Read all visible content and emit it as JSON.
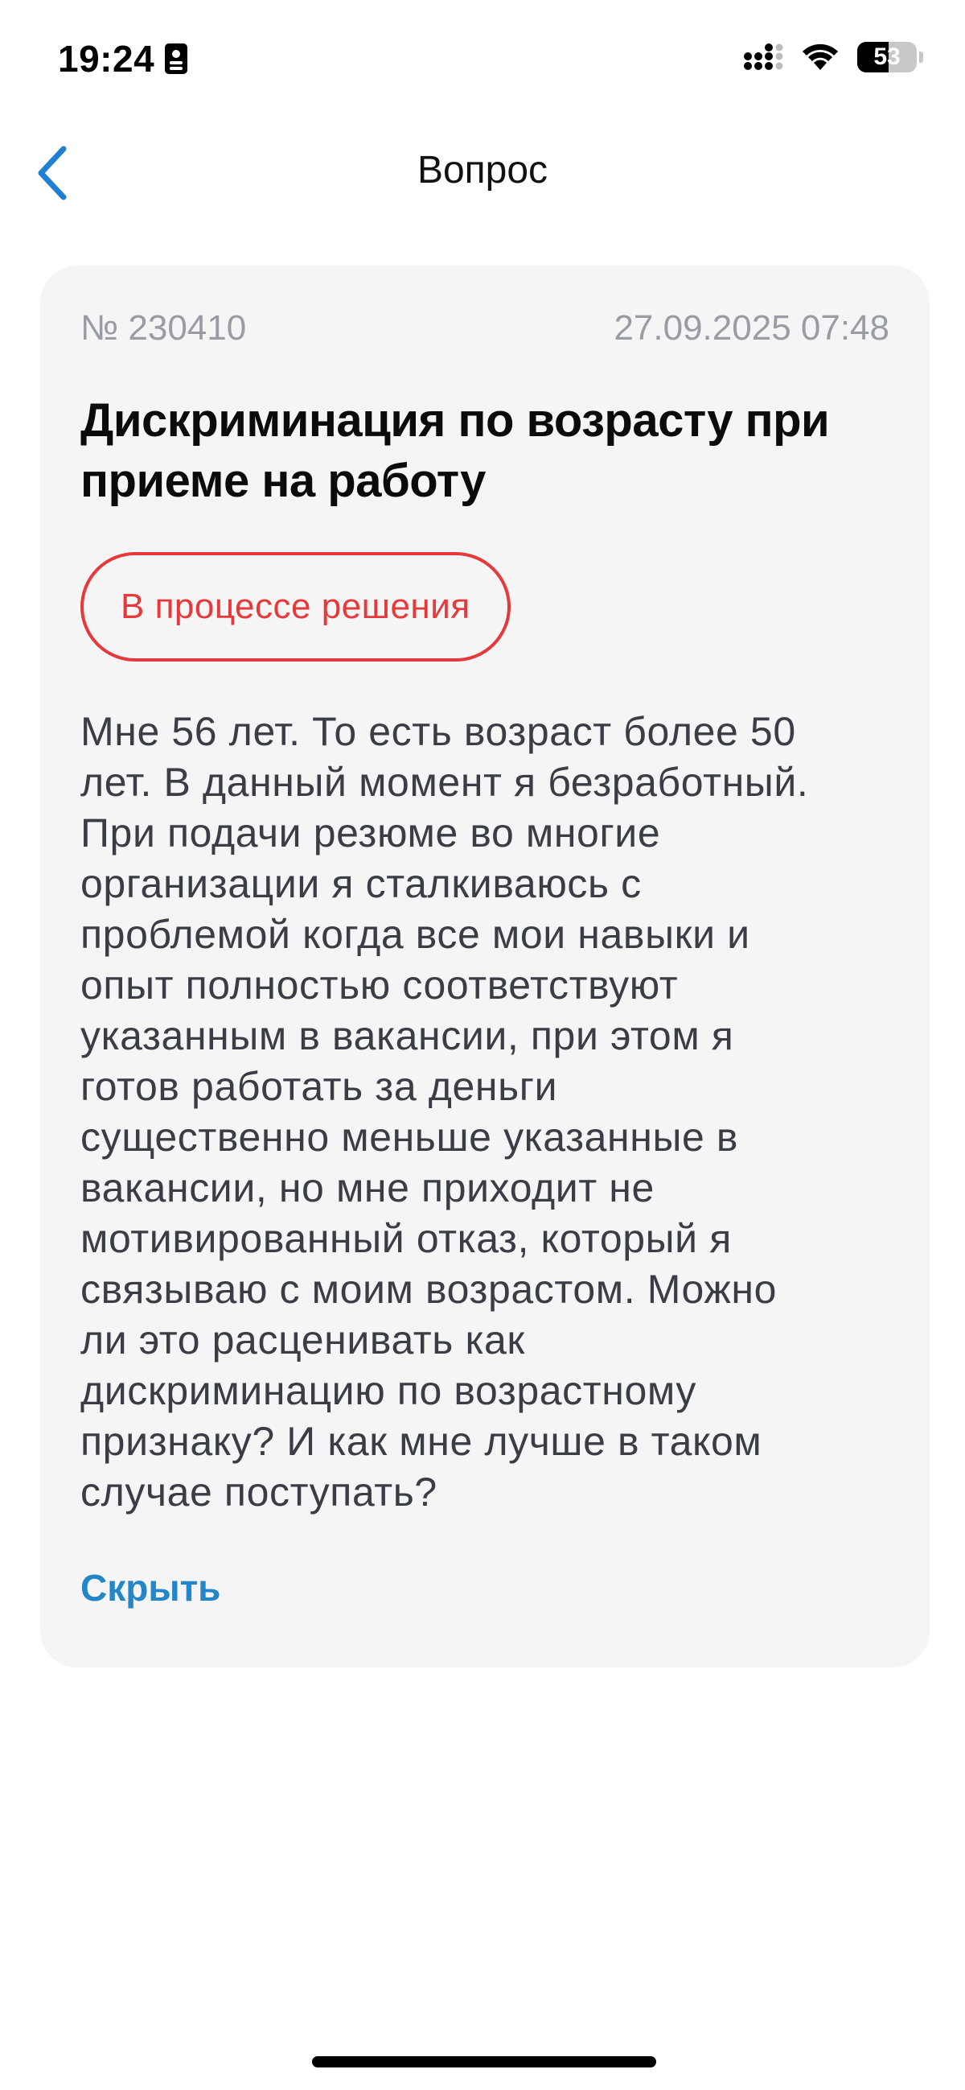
{
  "status_bar": {
    "time": "19:24",
    "battery_level": "53",
    "battery_percent": 53,
    "icons": [
      "id-card-icon",
      "cellular-signal-icon",
      "wifi-icon",
      "battery-icon"
    ]
  },
  "nav": {
    "back_icon": "chevron-left-icon",
    "title": "Вопрос"
  },
  "question": {
    "number": "№ 230410",
    "datetime": "27.09.2025 07:48",
    "title": "Дискриминация по возрасту при приеме на работу",
    "status": "В процессе решения",
    "body": "Мне 56 лет. То есть возраст более 50\nлет. В данный момент я безработный.\nПри подачи резюме во многие\nорганизации я сталкиваюсь с\nпроблемой когда все мои навыки и\nопыт полностью соответствуют\nуказанным в вакансии, при этом я\nготов работать за деньги\nсущественно меньше указанные в\nвакансии, но мне приходит не\nмотивированный отказ, который я\nсвязываю с моим возрастом. Можно\nли это расценивать как\nдискриминацию по возрастному\nпризнаку? И как мне лучше в таком\nслучае поступать?",
    "hide_label": "Скрыть"
  },
  "colors": {
    "accent": "#2386c8",
    "back_chevron": "#1f7fd1",
    "status_red": "#e5393b",
    "card_bg": "#f5f5f6",
    "meta_gray": "#9a9ca3",
    "body_text": "#3b3d45"
  }
}
